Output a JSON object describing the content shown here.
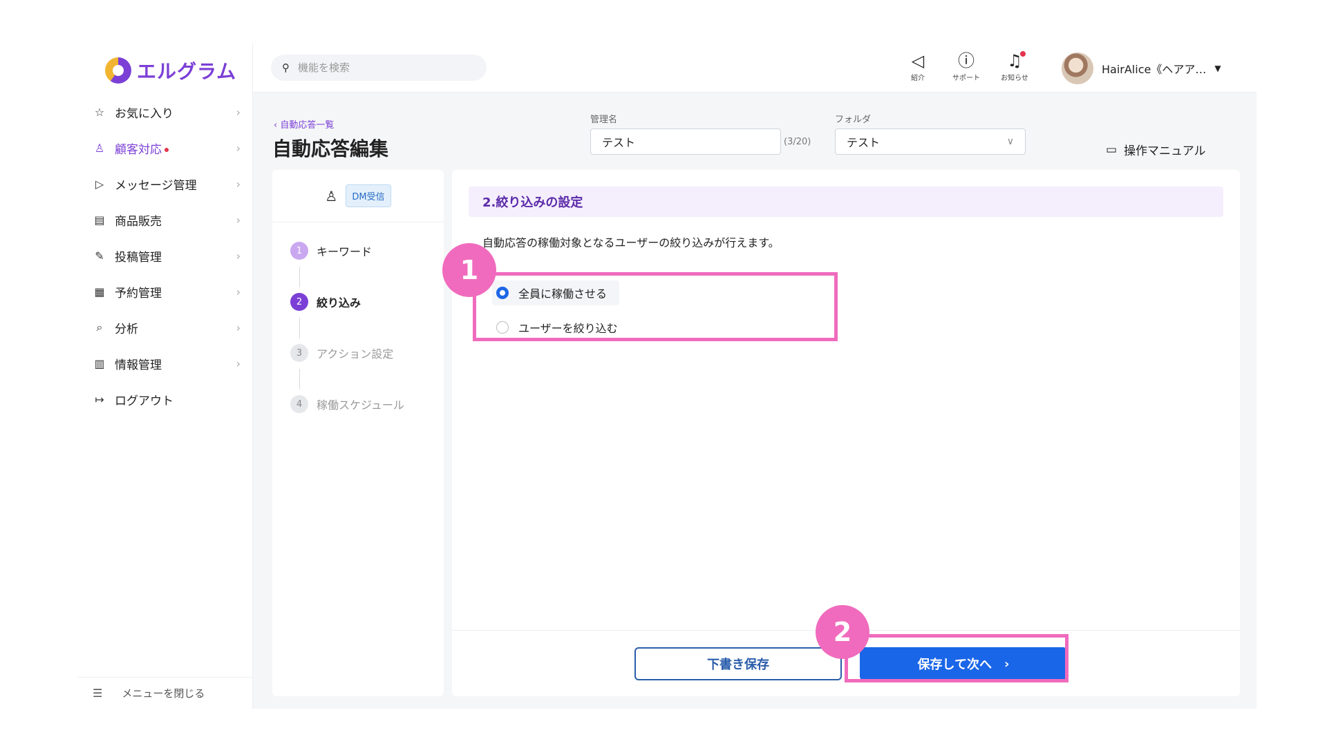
{
  "app": {
    "logo_text": "エルグラム",
    "brand_color": "#7b3fd6"
  },
  "sidebar": {
    "items": [
      {
        "label": "お気に入り",
        "icon": "star-icon",
        "active": false
      },
      {
        "label": "顧客対応",
        "icon": "person-icon",
        "active": true
      },
      {
        "label": "メッセージ管理",
        "icon": "send-icon",
        "active": false
      },
      {
        "label": "商品販売",
        "icon": "store-icon",
        "active": false
      },
      {
        "label": "投稿管理",
        "icon": "edit-icon",
        "active": false
      },
      {
        "label": "予約管理",
        "icon": "calendar-icon",
        "active": false
      },
      {
        "label": "分析",
        "icon": "report-icon",
        "active": false
      },
      {
        "label": "情報管理",
        "icon": "bar-chart-icon",
        "active": false
      },
      {
        "label": "ログアウト",
        "icon": "logout-icon",
        "active": false
      }
    ],
    "collapse_label": "メニューを閉じる"
  },
  "header": {
    "search_placeholder": "機能を検索",
    "icons": [
      {
        "label": "紹介",
        "icon": "megaphone-icon"
      },
      {
        "label": "サポート",
        "icon": "help-icon"
      },
      {
        "label": "お知らせ",
        "icon": "bell-icon"
      }
    ],
    "user_name": "HairAlice《ヘアア…"
  },
  "page": {
    "breadcrumb": "自動応答一覧",
    "title": "自動応答編集",
    "name_label": "管理名",
    "name_value": "テスト",
    "name_counter": "(3/20)",
    "folder_label": "フォルダ",
    "folder_value": "テスト",
    "manual_label": "操作マニュアル"
  },
  "steps": {
    "badge": "DM受信",
    "items": [
      {
        "num": "1",
        "label": "キーワード",
        "state": "done"
      },
      {
        "num": "2",
        "label": "絞り込み",
        "state": "current"
      },
      {
        "num": "3",
        "label": "アクション設定",
        "state": "todo"
      },
      {
        "num": "4",
        "label": "稼働スケジュール",
        "state": "todo"
      }
    ]
  },
  "main": {
    "section_title": "2.絞り込みの設定",
    "description": "自動応答の稼働対象となるユーザーの絞り込みが行えます。",
    "options": [
      {
        "label": "全員に稼働させる",
        "selected": true
      },
      {
        "label": "ユーザーを絞り込む",
        "selected": false
      }
    ],
    "draft_button": "下書き保存",
    "next_button": "保存して次へ"
  },
  "annotations": {
    "mark1": "1",
    "mark2": "2",
    "color": "#f06bbd"
  }
}
